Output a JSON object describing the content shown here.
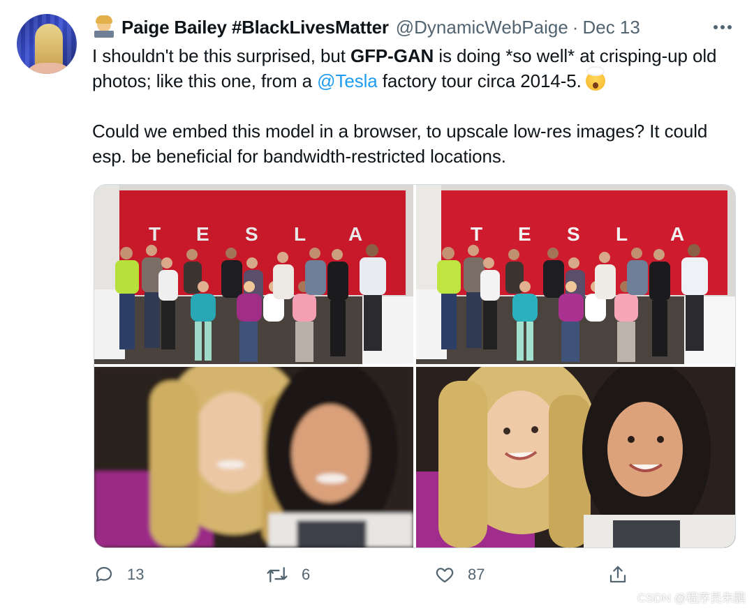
{
  "author": {
    "display_name": "Paige Bailey #BlackLivesMatter",
    "handle": "@DynamicWebPaige",
    "separator": "·",
    "date": "Dec 13"
  },
  "tweet": {
    "p1_a": "I shouldn't be this surprised, but ",
    "p1_bold": "GFP-GAN",
    "p1_b": " is doing *so well* at crisping-up old photos; like this one, from a ",
    "p1_mention": "@Tesla",
    "p1_c": " factory tour circa 2014-5.",
    "p2": "Could we embed this model in a browser, to upscale low-res images? It could esp. be beneficial for bandwidth-restricted locations."
  },
  "photos": {
    "wall_letters": [
      "T",
      "E",
      "S",
      "L",
      "A"
    ]
  },
  "actions": {
    "reply_count": "13",
    "retweet_count": "6",
    "like_count": "87"
  },
  "icons": {
    "reply": "reply-icon",
    "retweet": "retweet-icon",
    "like": "heart-icon",
    "share": "share-icon",
    "more": "more-icon"
  },
  "colors": {
    "text": "#0f1419",
    "secondary": "#536471",
    "link": "#1d9bf0",
    "border": "#cfd9de",
    "tesla_red": "#c8192b"
  },
  "watermark": "CSDN @程序员朱鹏"
}
